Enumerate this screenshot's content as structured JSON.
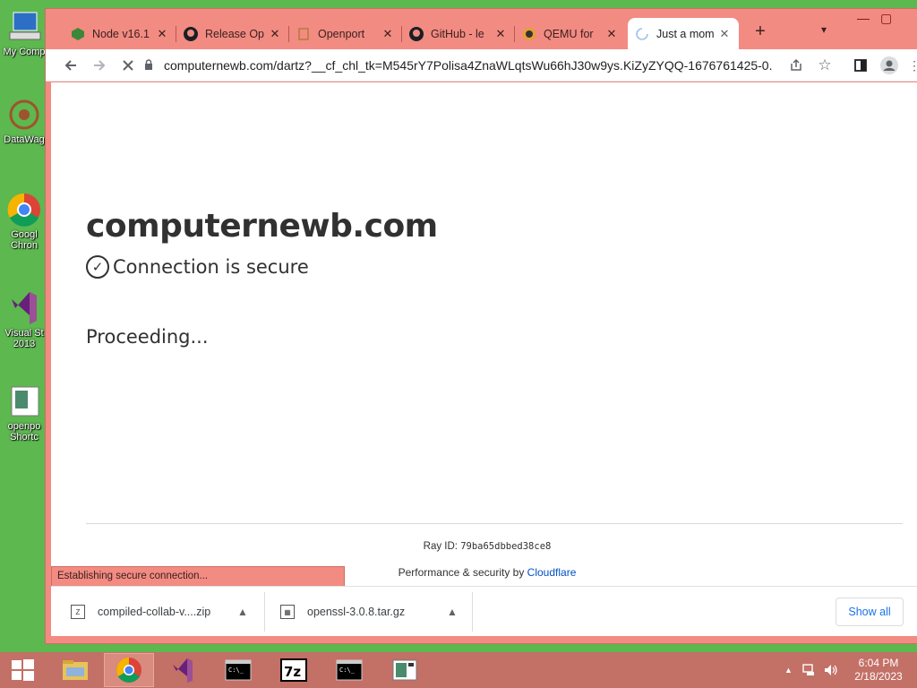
{
  "desktop": {
    "icons": [
      {
        "label": "My Comp",
        "icon": "computer-icon"
      },
      {
        "label": "DataWag",
        "icon": "datawag-icon"
      },
      {
        "label": "Googl\nChron",
        "icon": "chrome-icon"
      },
      {
        "label": "Visual St\n2013",
        "icon": "visual-studio-icon"
      },
      {
        "label": "openpo\nShortc",
        "icon": "shortcut-icon"
      }
    ]
  },
  "browser": {
    "tabs": [
      {
        "title": "Node v16.1",
        "icon": "node-icon",
        "active": false
      },
      {
        "title": "Release Op",
        "icon": "github-icon",
        "active": false
      },
      {
        "title": "Openport",
        "icon": "openport-icon",
        "active": false
      },
      {
        "title": "GitHub - le",
        "icon": "github-icon",
        "active": false
      },
      {
        "title": "QEMU for",
        "icon": "qemu-icon",
        "active": false
      },
      {
        "title": "Just a mom",
        "icon": "loading-spinner-icon",
        "active": true
      }
    ],
    "address": "computernewb.com/dartz?__cf_chl_tk=M545rY7Polisa4ZnaWLqtsWu66hJ30w9ys.KiZyZYQQ-1676761425-0...",
    "status_text": "Establishing secure connection..."
  },
  "page": {
    "site_name": "computernewb.com",
    "secure_text": "Connection is secure",
    "proceeding_text": "Proceeding...",
    "ray_label": "Ray ID:",
    "ray_id": "79ba65dbbed38ce8",
    "perf_label": "Performance & security by",
    "perf_link": "Cloudflare"
  },
  "downloads": {
    "items": [
      {
        "name": "compiled-collab-v....zip",
        "icon": "zip-file-icon"
      },
      {
        "name": "openssl-3.0.8.tar.gz",
        "icon": "archive-file-icon"
      }
    ],
    "show_all": "Show all"
  },
  "taskbar": {
    "time": "6:04 PM",
    "date": "2/18/2023"
  }
}
